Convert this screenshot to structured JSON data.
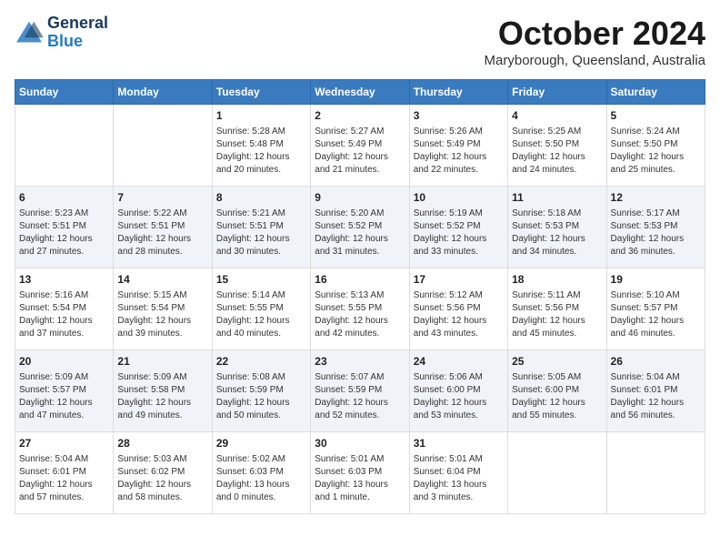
{
  "header": {
    "logo_line1": "General",
    "logo_line2": "Blue",
    "month_title": "October 2024",
    "location": "Maryborough, Queensland, Australia"
  },
  "weekdays": [
    "Sunday",
    "Monday",
    "Tuesday",
    "Wednesday",
    "Thursday",
    "Friday",
    "Saturday"
  ],
  "weeks": [
    [
      {
        "day": "",
        "empty": true
      },
      {
        "day": "",
        "empty": true
      },
      {
        "day": "1",
        "sunrise": "Sunrise: 5:28 AM",
        "sunset": "Sunset: 5:48 PM",
        "daylight": "Daylight: 12 hours and 20 minutes."
      },
      {
        "day": "2",
        "sunrise": "Sunrise: 5:27 AM",
        "sunset": "Sunset: 5:49 PM",
        "daylight": "Daylight: 12 hours and 21 minutes."
      },
      {
        "day": "3",
        "sunrise": "Sunrise: 5:26 AM",
        "sunset": "Sunset: 5:49 PM",
        "daylight": "Daylight: 12 hours and 22 minutes."
      },
      {
        "day": "4",
        "sunrise": "Sunrise: 5:25 AM",
        "sunset": "Sunset: 5:50 PM",
        "daylight": "Daylight: 12 hours and 24 minutes."
      },
      {
        "day": "5",
        "sunrise": "Sunrise: 5:24 AM",
        "sunset": "Sunset: 5:50 PM",
        "daylight": "Daylight: 12 hours and 25 minutes."
      }
    ],
    [
      {
        "day": "6",
        "sunrise": "Sunrise: 5:23 AM",
        "sunset": "Sunset: 5:51 PM",
        "daylight": "Daylight: 12 hours and 27 minutes."
      },
      {
        "day": "7",
        "sunrise": "Sunrise: 5:22 AM",
        "sunset": "Sunset: 5:51 PM",
        "daylight": "Daylight: 12 hours and 28 minutes."
      },
      {
        "day": "8",
        "sunrise": "Sunrise: 5:21 AM",
        "sunset": "Sunset: 5:51 PM",
        "daylight": "Daylight: 12 hours and 30 minutes."
      },
      {
        "day": "9",
        "sunrise": "Sunrise: 5:20 AM",
        "sunset": "Sunset: 5:52 PM",
        "daylight": "Daylight: 12 hours and 31 minutes."
      },
      {
        "day": "10",
        "sunrise": "Sunrise: 5:19 AM",
        "sunset": "Sunset: 5:52 PM",
        "daylight": "Daylight: 12 hours and 33 minutes."
      },
      {
        "day": "11",
        "sunrise": "Sunrise: 5:18 AM",
        "sunset": "Sunset: 5:53 PM",
        "daylight": "Daylight: 12 hours and 34 minutes."
      },
      {
        "day": "12",
        "sunrise": "Sunrise: 5:17 AM",
        "sunset": "Sunset: 5:53 PM",
        "daylight": "Daylight: 12 hours and 36 minutes."
      }
    ],
    [
      {
        "day": "13",
        "sunrise": "Sunrise: 5:16 AM",
        "sunset": "Sunset: 5:54 PM",
        "daylight": "Daylight: 12 hours and 37 minutes."
      },
      {
        "day": "14",
        "sunrise": "Sunrise: 5:15 AM",
        "sunset": "Sunset: 5:54 PM",
        "daylight": "Daylight: 12 hours and 39 minutes."
      },
      {
        "day": "15",
        "sunrise": "Sunrise: 5:14 AM",
        "sunset": "Sunset: 5:55 PM",
        "daylight": "Daylight: 12 hours and 40 minutes."
      },
      {
        "day": "16",
        "sunrise": "Sunrise: 5:13 AM",
        "sunset": "Sunset: 5:55 PM",
        "daylight": "Daylight: 12 hours and 42 minutes."
      },
      {
        "day": "17",
        "sunrise": "Sunrise: 5:12 AM",
        "sunset": "Sunset: 5:56 PM",
        "daylight": "Daylight: 12 hours and 43 minutes."
      },
      {
        "day": "18",
        "sunrise": "Sunrise: 5:11 AM",
        "sunset": "Sunset: 5:56 PM",
        "daylight": "Daylight: 12 hours and 45 minutes."
      },
      {
        "day": "19",
        "sunrise": "Sunrise: 5:10 AM",
        "sunset": "Sunset: 5:57 PM",
        "daylight": "Daylight: 12 hours and 46 minutes."
      }
    ],
    [
      {
        "day": "20",
        "sunrise": "Sunrise: 5:09 AM",
        "sunset": "Sunset: 5:57 PM",
        "daylight": "Daylight: 12 hours and 47 minutes."
      },
      {
        "day": "21",
        "sunrise": "Sunrise: 5:09 AM",
        "sunset": "Sunset: 5:58 PM",
        "daylight": "Daylight: 12 hours and 49 minutes."
      },
      {
        "day": "22",
        "sunrise": "Sunrise: 5:08 AM",
        "sunset": "Sunset: 5:59 PM",
        "daylight": "Daylight: 12 hours and 50 minutes."
      },
      {
        "day": "23",
        "sunrise": "Sunrise: 5:07 AM",
        "sunset": "Sunset: 5:59 PM",
        "daylight": "Daylight: 12 hours and 52 minutes."
      },
      {
        "day": "24",
        "sunrise": "Sunrise: 5:06 AM",
        "sunset": "Sunset: 6:00 PM",
        "daylight": "Daylight: 12 hours and 53 minutes."
      },
      {
        "day": "25",
        "sunrise": "Sunrise: 5:05 AM",
        "sunset": "Sunset: 6:00 PM",
        "daylight": "Daylight: 12 hours and 55 minutes."
      },
      {
        "day": "26",
        "sunrise": "Sunrise: 5:04 AM",
        "sunset": "Sunset: 6:01 PM",
        "daylight": "Daylight: 12 hours and 56 minutes."
      }
    ],
    [
      {
        "day": "27",
        "sunrise": "Sunrise: 5:04 AM",
        "sunset": "Sunset: 6:01 PM",
        "daylight": "Daylight: 12 hours and 57 minutes."
      },
      {
        "day": "28",
        "sunrise": "Sunrise: 5:03 AM",
        "sunset": "Sunset: 6:02 PM",
        "daylight": "Daylight: 12 hours and 58 minutes."
      },
      {
        "day": "29",
        "sunrise": "Sunrise: 5:02 AM",
        "sunset": "Sunset: 6:03 PM",
        "daylight": "Daylight: 13 hours and 0 minutes."
      },
      {
        "day": "30",
        "sunrise": "Sunrise: 5:01 AM",
        "sunset": "Sunset: 6:03 PM",
        "daylight": "Daylight: 13 hours and 1 minute."
      },
      {
        "day": "31",
        "sunrise": "Sunrise: 5:01 AM",
        "sunset": "Sunset: 6:04 PM",
        "daylight": "Daylight: 13 hours and 3 minutes."
      },
      {
        "day": "",
        "empty": true
      },
      {
        "day": "",
        "empty": true
      }
    ]
  ]
}
